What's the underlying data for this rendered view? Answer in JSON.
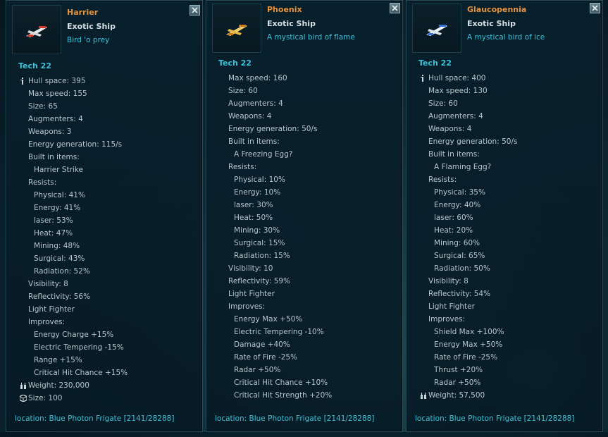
{
  "colors": {
    "name": "#e8913c",
    "accent": "#3fc1d8",
    "text": "#b8c6cc"
  },
  "panels": [
    {
      "name": "Harrier",
      "type": "Exotic Ship",
      "desc": "Bird 'o prey",
      "tech": "Tech 22",
      "ship_icon": "red-white-ship-icon",
      "rows": [
        {
          "text": "Hull space: 395",
          "indent": 0,
          "icon": "info-icon"
        },
        {
          "text": "Max speed: 155",
          "indent": 0
        },
        {
          "text": "Size: 65",
          "indent": 0
        },
        {
          "text": "Augmenters: 4",
          "indent": 0
        },
        {
          "text": "Weapons: 3",
          "indent": 0
        },
        {
          "text": "Energy generation: 115/s",
          "indent": 0
        },
        {
          "text": "Built in items:",
          "indent": 0
        },
        {
          "text": "Harrier Strike",
          "indent": 1
        },
        {
          "text": "Resists:",
          "indent": 0
        },
        {
          "text": "Physical: 41%",
          "indent": 1
        },
        {
          "text": "Energy: 41%",
          "indent": 1
        },
        {
          "text": "laser: 53%",
          "indent": 1
        },
        {
          "text": "Heat: 47%",
          "indent": 1
        },
        {
          "text": "Mining: 48%",
          "indent": 1
        },
        {
          "text": "Surgical: 43%",
          "indent": 1
        },
        {
          "text": "Radiation: 52%",
          "indent": 1
        },
        {
          "text": "Visibility: 8",
          "indent": 0
        },
        {
          "text": "Reflectivity: 56%",
          "indent": 0
        },
        {
          "text": "Light Fighter",
          "indent": 0
        },
        {
          "text": "Improves:",
          "indent": 0
        },
        {
          "text": "Energy Charge +15%",
          "indent": 1
        },
        {
          "text": "Electric Tempering -15%",
          "indent": 1
        },
        {
          "text": "Range +15%",
          "indent": 1
        },
        {
          "text": "Critical Hit Chance +15%",
          "indent": 1
        },
        {
          "text": "Weight: 230,000",
          "indent": 0,
          "icon": "weight-icon"
        },
        {
          "text": "Size: 100",
          "indent": 0,
          "icon": "cube-icon"
        }
      ],
      "location": "location: Blue Photon Frigate [2141/28288]"
    },
    {
      "name": "Phoenix",
      "type": "Exotic Ship",
      "desc": "A mystical bird of flame",
      "tech": "Tech 22",
      "ship_icon": "gold-ship-icon",
      "rows": [
        {
          "text": "Max speed: 160",
          "indent": 0
        },
        {
          "text": "Size: 60",
          "indent": 0
        },
        {
          "text": "Augmenters: 4",
          "indent": 0
        },
        {
          "text": "Weapons: 4",
          "indent": 0
        },
        {
          "text": "Energy generation: 50/s",
          "indent": 0
        },
        {
          "text": "Built in items:",
          "indent": 0
        },
        {
          "text": "A Freezing Egg?",
          "indent": 1
        },
        {
          "text": "Resists:",
          "indent": 0
        },
        {
          "text": "Physical: 10%",
          "indent": 1
        },
        {
          "text": "Energy: 10%",
          "indent": 1
        },
        {
          "text": "laser: 30%",
          "indent": 1
        },
        {
          "text": "Heat: 50%",
          "indent": 1
        },
        {
          "text": "Mining: 30%",
          "indent": 1
        },
        {
          "text": "Surgical: 15%",
          "indent": 1
        },
        {
          "text": "Radiation: 15%",
          "indent": 1
        },
        {
          "text": "Visibility: 10",
          "indent": 0
        },
        {
          "text": "Reflectivity: 59%",
          "indent": 0
        },
        {
          "text": "Light Fighter",
          "indent": 0
        },
        {
          "text": "Improves:",
          "indent": 0
        },
        {
          "text": "Energy Max +50%",
          "indent": 1
        },
        {
          "text": "Electric Tempering -10%",
          "indent": 1
        },
        {
          "text": "Damage +40%",
          "indent": 1
        },
        {
          "text": "Rate of Fire -25%",
          "indent": 1
        },
        {
          "text": "Radar +50%",
          "indent": 1
        },
        {
          "text": "Critical Hit Chance +10%",
          "indent": 1
        },
        {
          "text": "Critical Hit Strength +20%",
          "indent": 1
        }
      ],
      "location": "location: Blue Photon Frigate [2141/28288]"
    },
    {
      "name": "Glaucopennia",
      "type": "Exotic Ship",
      "desc": "A mystical bird of ice",
      "tech": "Tech 22",
      "ship_icon": "blue-white-ship-icon",
      "rows": [
        {
          "text": "Hull space: 400",
          "indent": 0,
          "icon": "info-icon"
        },
        {
          "text": "Max speed: 130",
          "indent": 0
        },
        {
          "text": "Size: 60",
          "indent": 0
        },
        {
          "text": "Augmenters: 4",
          "indent": 0
        },
        {
          "text": "Weapons: 4",
          "indent": 0
        },
        {
          "text": "Energy generation: 50/s",
          "indent": 0
        },
        {
          "text": "Built in items:",
          "indent": 0
        },
        {
          "text": "A Flaming Egg?",
          "indent": 1
        },
        {
          "text": "Resists:",
          "indent": 0
        },
        {
          "text": "Physical: 35%",
          "indent": 1
        },
        {
          "text": "Energy: 40%",
          "indent": 1
        },
        {
          "text": "laser: 60%",
          "indent": 1
        },
        {
          "text": "Heat: 20%",
          "indent": 1
        },
        {
          "text": "Mining: 60%",
          "indent": 1
        },
        {
          "text": "Surgical: 65%",
          "indent": 1
        },
        {
          "text": "Radiation: 50%",
          "indent": 1
        },
        {
          "text": "Visibility: 8",
          "indent": 0
        },
        {
          "text": "Reflectivity: 54%",
          "indent": 0
        },
        {
          "text": "Light Fighter",
          "indent": 0
        },
        {
          "text": "Improves:",
          "indent": 0
        },
        {
          "text": "Shield Max +100%",
          "indent": 1
        },
        {
          "text": "Energy Max +50%",
          "indent": 1
        },
        {
          "text": "Rate of Fire -25%",
          "indent": 1
        },
        {
          "text": "Thrust +20%",
          "indent": 1
        },
        {
          "text": "Radar +50%",
          "indent": 1
        },
        {
          "text": "Weight: 57,500",
          "indent": 0,
          "icon": "weight-icon"
        }
      ],
      "location": "location: Blue Photon Frigate [2141/28288]"
    }
  ]
}
